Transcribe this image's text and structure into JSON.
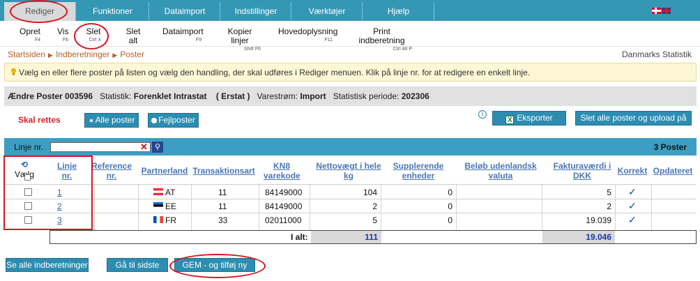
{
  "top_menu": [
    {
      "label": "Rediger"
    },
    {
      "label": "Funktioner"
    },
    {
      "label": "Dataimport"
    },
    {
      "label": "Indstillinger"
    },
    {
      "label": "Værktøjer"
    },
    {
      "label": "Hjælp"
    }
  ],
  "sub_menu": [
    {
      "label": "Opret",
      "shortcut": "F4"
    },
    {
      "label": "Vis",
      "shortcut": "F6"
    },
    {
      "label": "Slet",
      "shortcut": "Ctrl X"
    },
    {
      "label": "Slet alt",
      "shortcut": ""
    },
    {
      "label": "Dataimport",
      "shortcut": "F9"
    },
    {
      "label": "Kopier linjer",
      "shortcut": "Shift F6"
    },
    {
      "label": "Hovedoplysning",
      "shortcut": "F11"
    },
    {
      "label": "Print indberetning",
      "shortcut": "Ctrl Alt P"
    }
  ],
  "breadcrumb": [
    "Startsiden",
    "Indberetninger",
    "Poster"
  ],
  "organization": "Danmarks Statistik",
  "info_text": "Vælg en eller flere poster på listen og vælg den handling, der skal udføres i Rediger menuen. Klik på linje nr. for at redigere en enkelt linje.",
  "header": {
    "title": "Ændre Poster 003596",
    "stat_label": "Statistik:",
    "stat_value": "Forenklet Intrastat",
    "erstat": "( Erstat )",
    "flow_label": "Varestrøm:",
    "flow_value": "Import",
    "period_label": "Statistisk periode:",
    "period_value": "202306"
  },
  "filter": {
    "label": "Skal rettes",
    "all": "Alle poster",
    "errors": "Fejlposter",
    "selected": "all"
  },
  "actions": {
    "export": "Eksporter poster",
    "delete_upload": "Slet alle poster og upload på ny"
  },
  "table_bar": {
    "search_label": "Linje nr.",
    "search_value": "",
    "count": "3 Poster"
  },
  "columns": [
    "Vælg",
    "Linje nr.",
    "Reference nr.",
    "Partnerland",
    "Transaktionsart",
    "KN8 varekode",
    "Nettovægt i hele kg",
    "Supplerende enheder",
    "Beløb udenlandsk valuta",
    "Fakturaværdi i DKK",
    "Korrekt",
    "Opdateret"
  ],
  "rows": [
    {
      "line": "1",
      "ref": "",
      "country": "AT",
      "trans": "11",
      "kn8": "84149000",
      "weight": "104",
      "supp": "0",
      "foreign": "",
      "invoice": "5",
      "correct": "✓"
    },
    {
      "line": "2",
      "ref": "",
      "country": "EE",
      "trans": "11",
      "kn8": "84149000",
      "weight": "2",
      "supp": "0",
      "foreign": "",
      "invoice": "2",
      "correct": "✓"
    },
    {
      "line": "3",
      "ref": "",
      "country": "FR",
      "trans": "33",
      "kn8": "02011000",
      "weight": "5",
      "supp": "0",
      "foreign": "",
      "invoice": "19.039",
      "correct": "✓"
    }
  ],
  "totals": {
    "label": "I alt:",
    "weight": "111",
    "invoice": "19.046"
  },
  "bottom_buttons": {
    "all_reports": "Se alle indberetninger",
    "last_post": "Gå til sidste post",
    "save_new": "GEM - og tilføj ny post"
  }
}
